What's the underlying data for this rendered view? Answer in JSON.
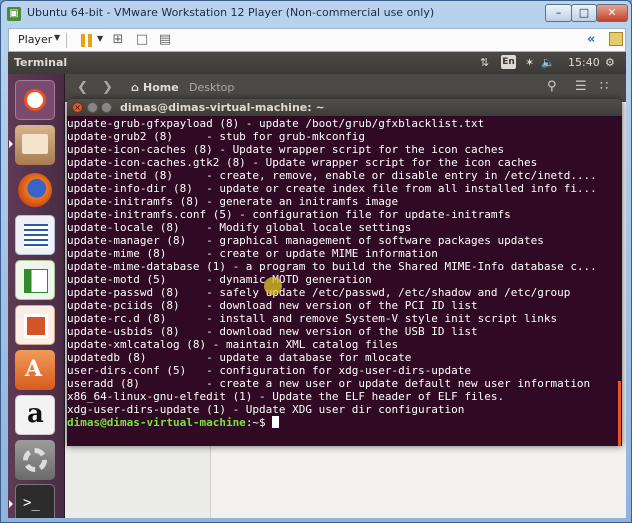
{
  "vmware": {
    "title": "Ubuntu 64-bit - VMware Workstation 12 Player (Non-commercial use only)",
    "player_label": "Player",
    "buttons": {
      "minimize": "–",
      "maximize": "□",
      "close": "✕"
    }
  },
  "ubuntu": {
    "topbar_title": "Terminal",
    "tray": {
      "keyboard": "En",
      "time": "15:40"
    },
    "nautilus": {
      "home_label": "Home",
      "desktop_label": "Desktop"
    }
  },
  "terminal": {
    "window_title": "dimas@dimas-virtual-machine: ~",
    "lines": [
      "update-grub-gfxpayload (8) - update /boot/grub/gfxblacklist.txt",
      "update-grub2 (8)     - stub for grub-mkconfig",
      "update-icon-caches (8) - Update wrapper script for the icon caches",
      "update-icon-caches.gtk2 (8) - Update wrapper script for the icon caches",
      "update-inetd (8)     - create, remove, enable or disable entry in /etc/inetd....",
      "update-info-dir (8)  - update or create index file from all installed info fi...",
      "update-initramfs (8) - generate an initramfs image",
      "update-initramfs.conf (5) - configuration file for update-initramfs",
      "update-locale (8)    - Modify global locale settings",
      "update-manager (8)   - graphical management of software packages updates",
      "update-mime (8)      - create or update MIME information",
      "update-mime-database (1) - a program to build the Shared MIME-Info database c...",
      "update-motd (5)      - dynamic MOTD generation",
      "update-passwd (8)    - safely update /etc/passwd, /etc/shadow and /etc/group",
      "update-pciids (8)    - download new version of the PCI ID list",
      "update-rc.d (8)      - install and remove System-V style init script links",
      "update-usbids (8)    - download new version of the USB ID list",
      "update-xmlcatalog (8) - maintain XML catalog files",
      "updatedb (8)         - update a database for mlocate",
      "user-dirs.conf (5)   - configuration for xdg-user-dirs-update",
      "useradd (8)          - create a new user or update default new user information",
      "x86_64-linux-gnu-elfedit (1) - Update the ELF header of ELF files.",
      "xdg-user-dirs-update (1) - Update XDG user dir configuration"
    ],
    "prompt": {
      "user": "dimas@dimas-virtual-machine",
      "suffix": ":~$ "
    }
  }
}
